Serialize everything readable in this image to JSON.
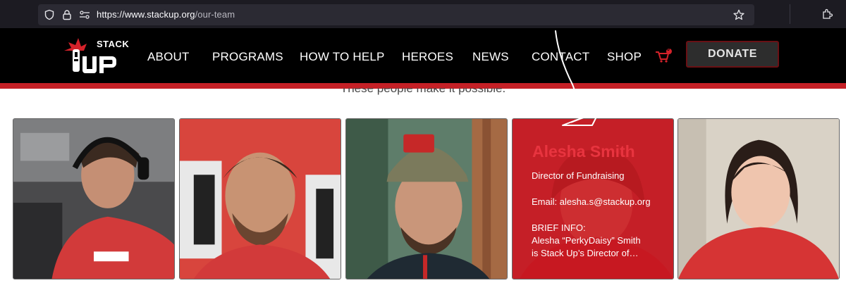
{
  "browser": {
    "url_host": "https://www.stackup.org",
    "url_path": "/our-team",
    "icons": [
      "shield-icon",
      "lock-icon",
      "permissions-icon",
      "bookmark-star-icon",
      "extensions-icon"
    ]
  },
  "header": {
    "logo_top": "STACK",
    "logo_bottom": "UP",
    "nav": [
      "ABOUT",
      "PROGRAMS",
      "HOW TO HELP",
      "HEROES",
      "NEWS",
      "CONTACT",
      "SHOP"
    ],
    "cart_count": "0",
    "donate_label": "DONATE"
  },
  "tagline": "These people make it possible.",
  "team": [
    {
      "photo": "man-with-headset"
    },
    {
      "photo": "man-with-goatee"
    },
    {
      "photo": "man-in-camo-cap"
    },
    {
      "photo": "woman-red-overlay",
      "name": "Alesha Smith",
      "title": "Director of Fundraising",
      "email": "Email: alesha.s@stackup.org",
      "brief_label": "BRIEF INFO:",
      "brief_line1": "Alesha “PerkyDaisy” Smith",
      "brief_line2": "is Stack Up’s Director of…"
    },
    {
      "photo": "woman-dark-hair"
    }
  ],
  "colors": {
    "brand_red": "#c42026",
    "header_bg": "#000000",
    "chrome_bg": "#1c1b22",
    "overlay_name": "#e8343f"
  }
}
